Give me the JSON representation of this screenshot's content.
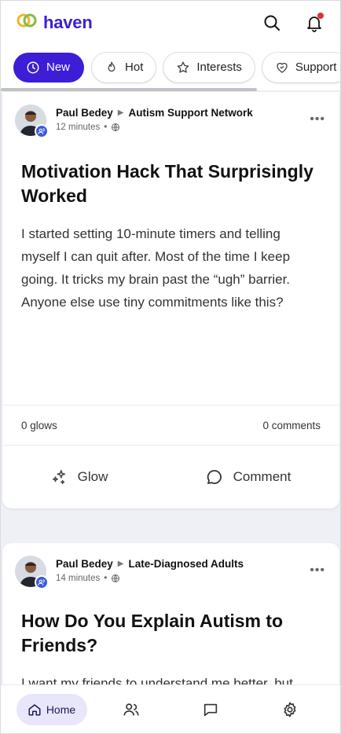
{
  "app": {
    "brand": "haven",
    "brand_colors": [
      "#f0b429",
      "#7fbf3f",
      "#3b1fd1"
    ]
  },
  "header": {
    "search_icon": "search-icon",
    "bell_icon": "bell-icon",
    "has_notification": true
  },
  "tabs": [
    {
      "label": "New",
      "icon": "clock-icon",
      "active": true
    },
    {
      "label": "Hot",
      "icon": "flame-icon",
      "active": false
    },
    {
      "label": "Interests",
      "icon": "star-icon",
      "active": false
    },
    {
      "label": "Support",
      "icon": "heart-handshake-icon",
      "active": false
    }
  ],
  "posts": [
    {
      "author": "Paul Bedey",
      "community": "Autism Support Network",
      "time": "12 minutes",
      "separator": "•",
      "title": "Motivation Hack That Surprisingly Worked",
      "body": "I started setting 10-minute timers and telling myself I can quit after. Most of the time I keep going. It tricks my brain past the “ugh” barrier. Anyone else use tiny commitments like this?",
      "glows": "0 glows",
      "comments": "0 comments",
      "glow_label": "Glow",
      "comment_label": "Comment"
    },
    {
      "author": "Paul Bedey",
      "community": "Late-Diagnosed Adults",
      "time": "14 minutes",
      "separator": "•",
      "title": "How Do You Explain Autism to Friends?",
      "body": "I want my friends to understand me better, but"
    }
  ],
  "bottom_nav": [
    {
      "label": "Home",
      "icon": "home-icon",
      "active": true
    },
    {
      "label": "",
      "icon": "people-icon",
      "active": false
    },
    {
      "label": "",
      "icon": "chat-icon",
      "active": false
    },
    {
      "label": "",
      "icon": "gear-icon",
      "active": false
    }
  ]
}
